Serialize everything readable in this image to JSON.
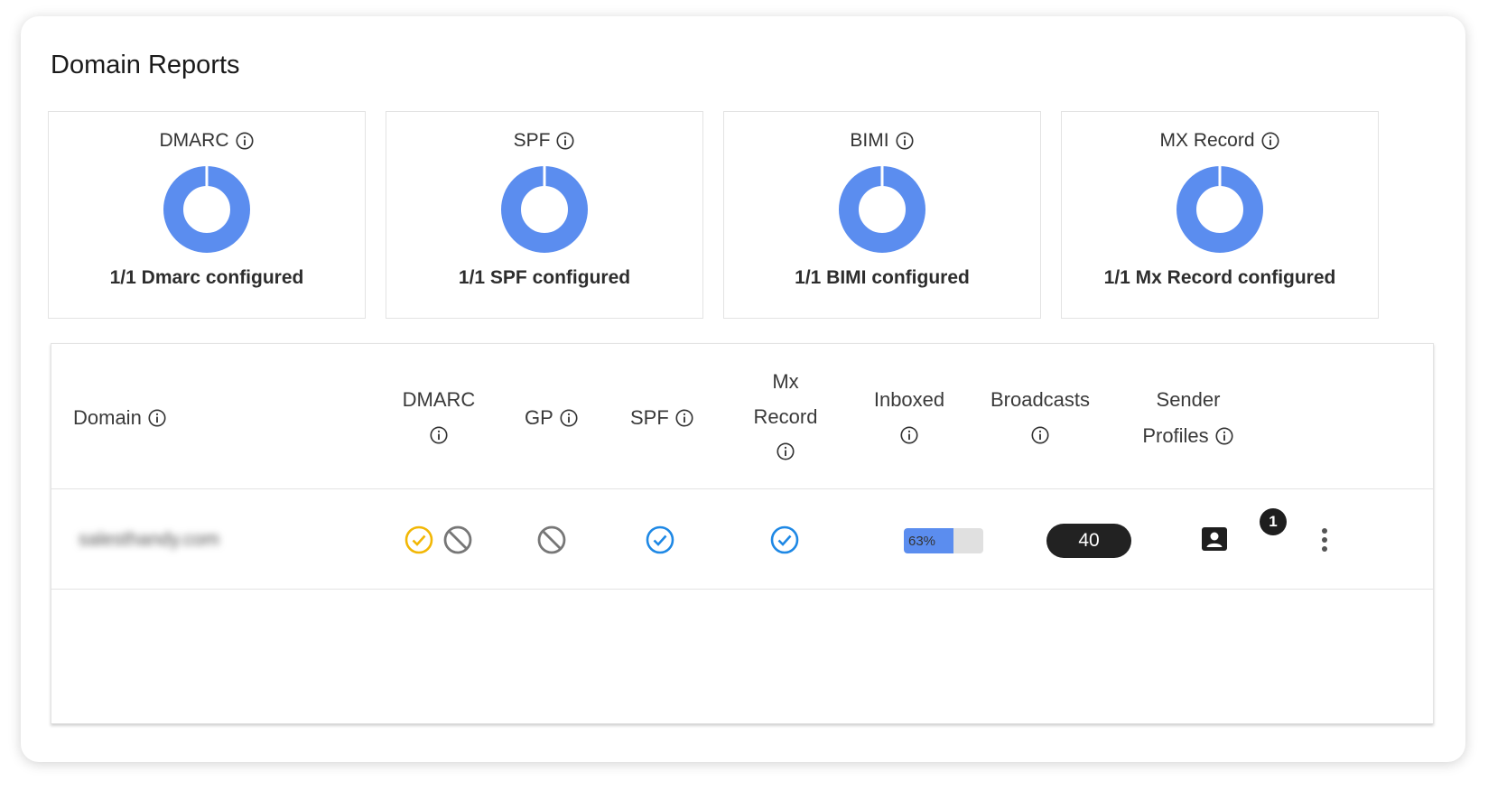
{
  "page": {
    "title": "Domain Reports"
  },
  "colors": {
    "donut": "#5b8def",
    "check_blue": "#1e88e5",
    "check_yellow": "#f2b705",
    "blocked": "#777777"
  },
  "stats": [
    {
      "label": "DMARC",
      "configured_fraction": 1.0,
      "summary": "1/1 Dmarc configured"
    },
    {
      "label": "SPF",
      "configured_fraction": 1.0,
      "summary": "1/1 SPF configured"
    },
    {
      "label": "BIMI",
      "configured_fraction": 1.0,
      "summary": "1/1 BIMI configured"
    },
    {
      "label": "MX Record",
      "configured_fraction": 1.0,
      "summary": "1/1 Mx Record configured"
    }
  ],
  "table": {
    "headers": {
      "domain": "Domain",
      "dmarc": "DMARC",
      "gp": "GP",
      "spf": "SPF",
      "mx_line1": "Mx",
      "mx_line2": "Record",
      "inboxed": "Inboxed",
      "broadcasts": "Broadcasts",
      "sender_line1": "Sender",
      "sender_line2": "Profiles"
    },
    "rows": [
      {
        "domain": "salesthandy.com",
        "dmarc_status": [
          "check-yellow-icon",
          "blocked-icon"
        ],
        "gp_status": "blocked-icon",
        "spf_status": "check-blue-icon",
        "mx_status": "check-blue-icon",
        "inboxed_percent": 63,
        "inboxed_label": "63%",
        "broadcasts": "40",
        "sender_profiles_count": "1"
      }
    ]
  }
}
